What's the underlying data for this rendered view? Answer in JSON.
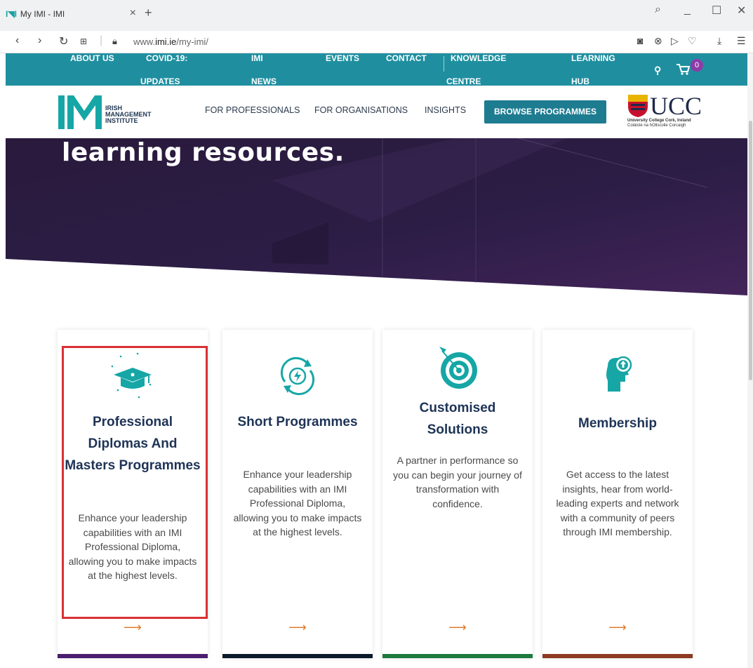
{
  "browser": {
    "tab_title": "My IMI - IMI",
    "url_prefix": "www.",
    "url_domain": "imi.ie",
    "url_path": "/my-imi/"
  },
  "topnav": {
    "items": [
      "ABOUT US",
      "COVID-19:",
      "UPDATES",
      "IMI",
      "NEWS",
      "EVENTS",
      "CONTACT",
      "KNOWLEDGE",
      "CENTRE",
      "LEARNING",
      "HUB"
    ],
    "cart_count": "0"
  },
  "mainnav": {
    "logo_lines": [
      "IRISH",
      "MANAGEMENT",
      "INSTITUTE"
    ],
    "links": [
      "FOR PROFESSIONALS",
      "FOR ORGANISATIONS",
      "INSIGHTS"
    ],
    "browse_label": "BROWSE PROGRAMMES",
    "partner_name": "UCC",
    "partner_sub1": "University College Cork, Ireland",
    "partner_sub2": "Coláiste na hOllscoile Corcaigh"
  },
  "hero": {
    "heading": "learning resources."
  },
  "cards": [
    {
      "title": "Professional Diplomas And Masters Programmes",
      "desc": "Enhance your leadership capabilities with an IMI Professional Diploma, allowing you to make impacts at the highest levels.",
      "arrow": "⟶",
      "accent": "#4b1d6e"
    },
    {
      "title": "Short Programmes",
      "desc": "Enhance your leadership capabilities with an IMI Professional Diploma, allowing you to make impacts at the highest levels.",
      "arrow": "⟶",
      "accent": "#0c1a2c"
    },
    {
      "title": "Customised Solutions",
      "desc": "A partner in performance so you can begin your journey of transformation with confidence.",
      "arrow": "⟶",
      "accent": "#1d7a3e"
    },
    {
      "title": "Membership",
      "desc": "Get access to the latest insights, hear from world-leading experts and network with a community of peers through IMI membership.",
      "arrow": "⟶",
      "accent": "#8c3a22"
    }
  ],
  "colors": {
    "teal": "#1f8fa0",
    "icon_teal": "#17a6a6",
    "highlight": "#d93034"
  }
}
